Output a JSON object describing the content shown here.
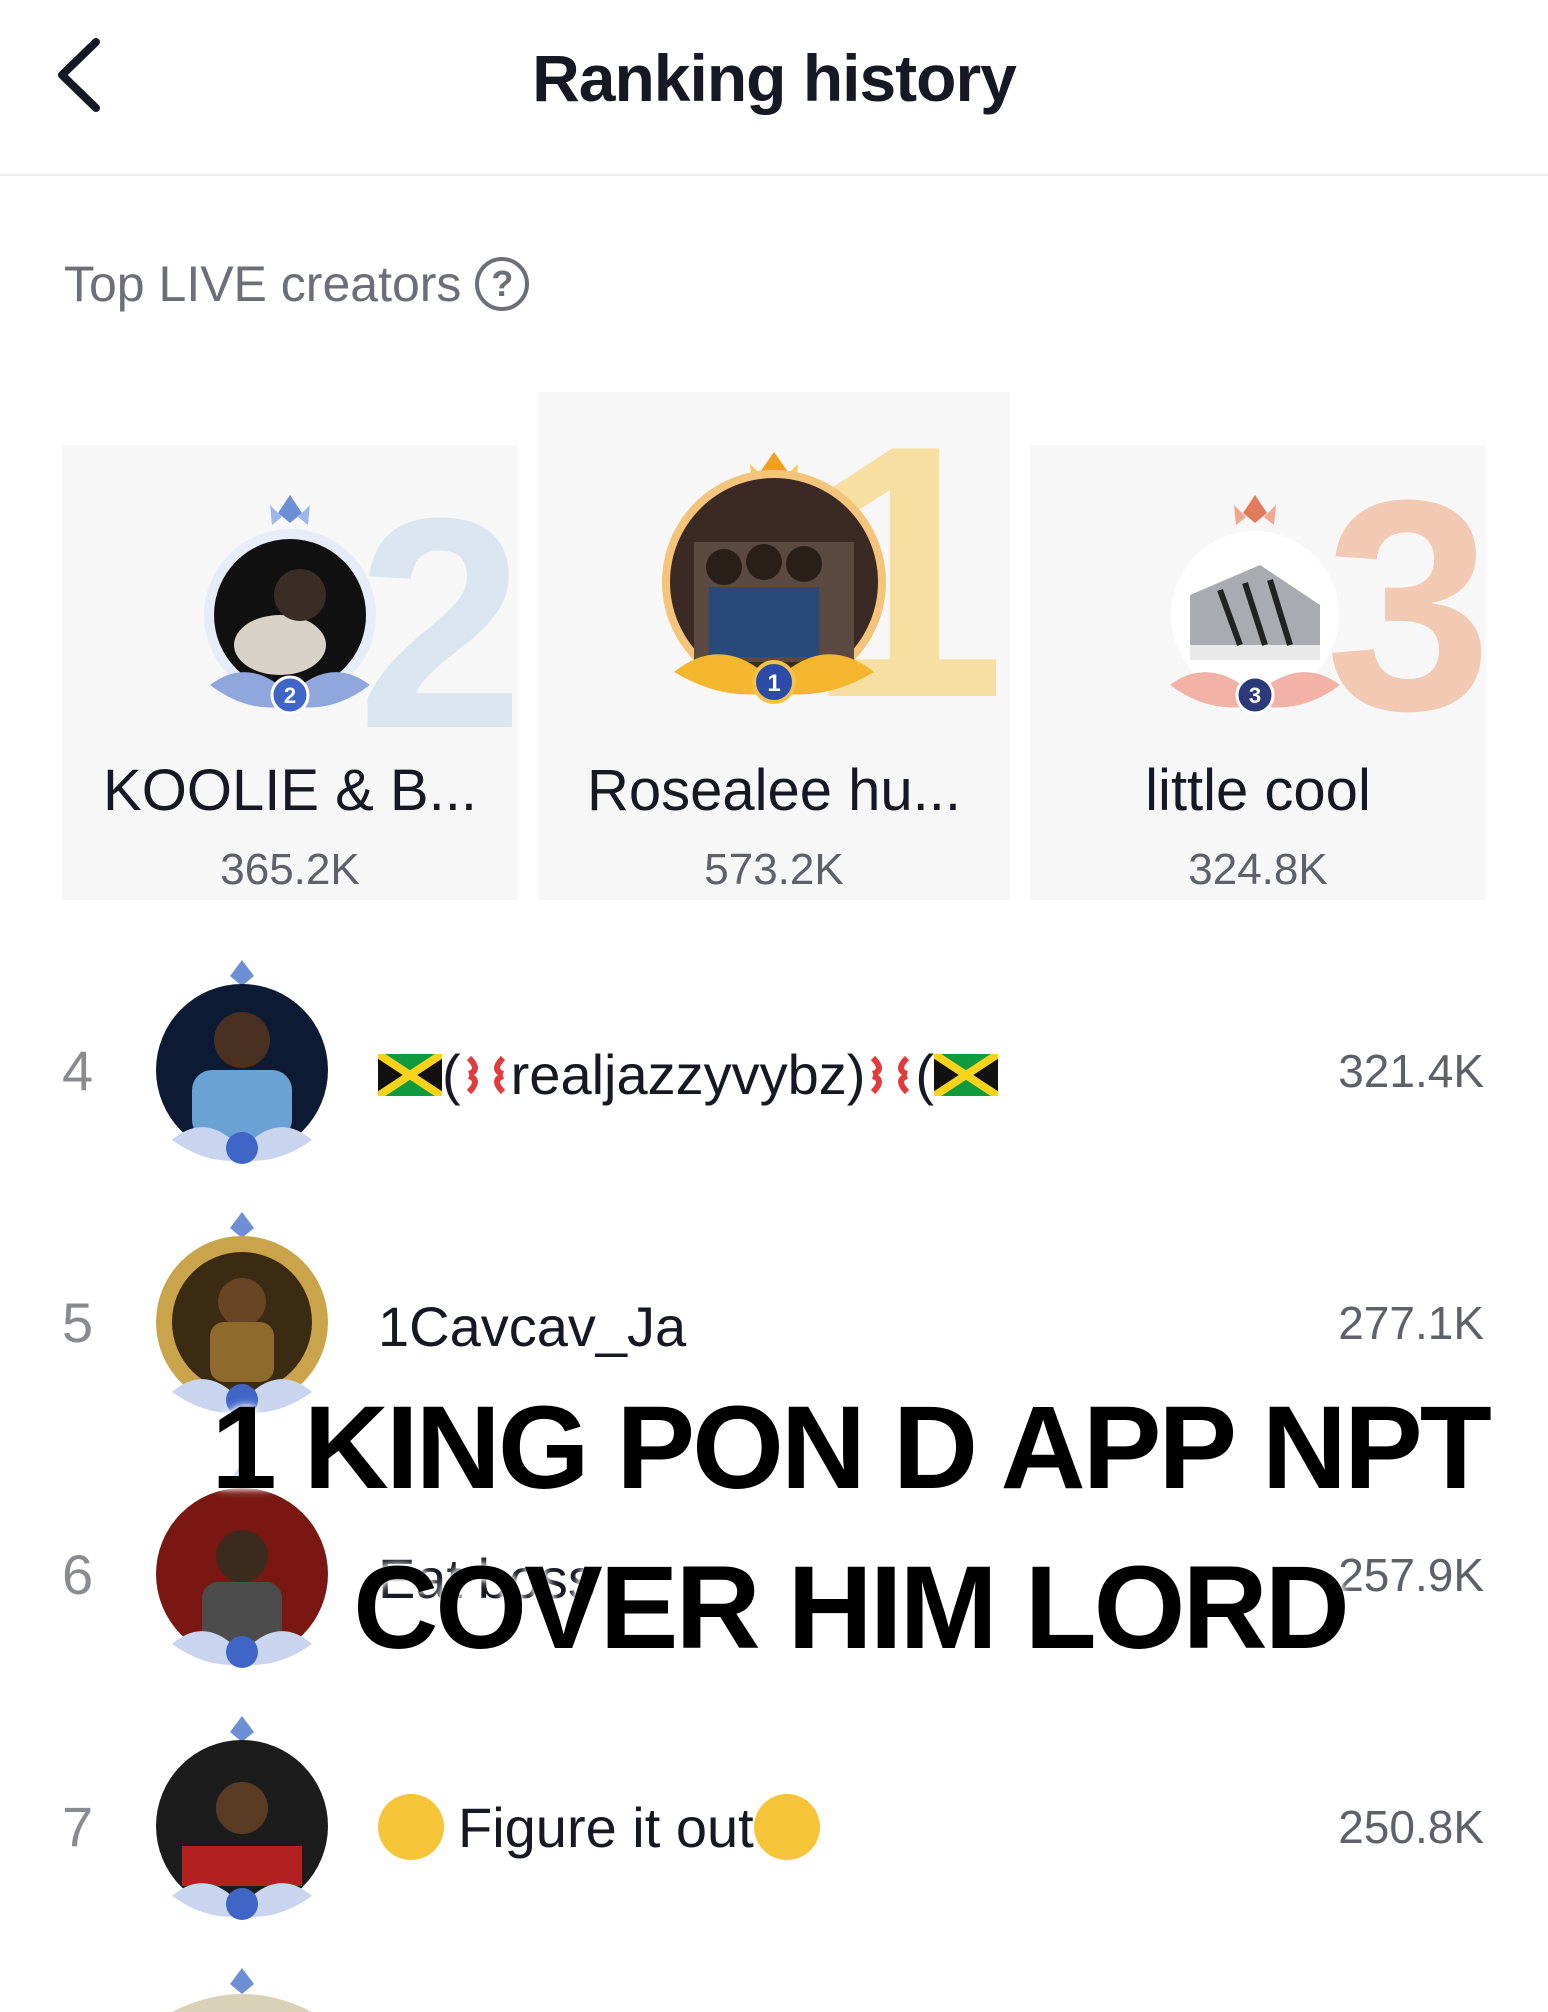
{
  "header": {
    "title": "Ranking history",
    "back_icon": "chevron-left-icon"
  },
  "section": {
    "label": "Top LIVE creators",
    "help_icon": "question-circle-icon"
  },
  "podium": [
    {
      "rank": 2,
      "rank_label": "2",
      "name": "KOOLIE & B...",
      "score": "365.2K",
      "accent": "#9db6d8"
    },
    {
      "rank": 1,
      "rank_label": "1",
      "name": "Rosealee hu...",
      "score": "573.2K",
      "accent": "#f2c35a"
    },
    {
      "rank": 3,
      "rank_label": "3",
      "name": "little cool",
      "score": "324.8K",
      "accent": "#f0b89a"
    }
  ],
  "rows": [
    {
      "rank": "4",
      "name": "realjazzyvybz",
      "name_prefix": "(",
      "name_suffix": ")",
      "score": "321.4K"
    },
    {
      "rank": "5",
      "name": "1Cavcav_Ja",
      "score": "277.1K"
    },
    {
      "rank": "6",
      "name": "Eat boss",
      "score": "257.9K"
    },
    {
      "rank": "7",
      "name": "Figure  it  out",
      "score": "250.8K"
    }
  ],
  "overlay": {
    "line1": "1 KING PON D APP NPT",
    "line2": "COVER HIM LORD"
  }
}
